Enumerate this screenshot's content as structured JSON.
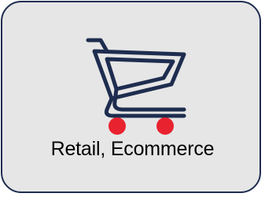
{
  "tile": {
    "label": "Retail, Ecommerce",
    "icon": "shopping-cart-icon"
  },
  "colors": {
    "background": "#e6e6e6",
    "border": "#1e2d4f",
    "cart_outline": "#1e2d4f",
    "wheels": "#e8232f",
    "text": "#000000"
  }
}
